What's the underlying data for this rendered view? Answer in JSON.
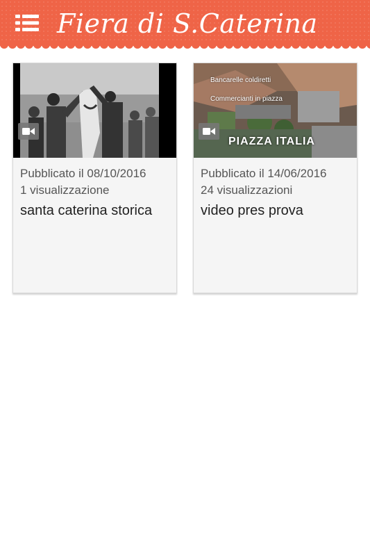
{
  "header": {
    "title": "Fiera di S.Caterina",
    "menu_icon": "hamburger-menu-icon",
    "background_color": "#ef6447"
  },
  "videos": [
    {
      "published": "Pubblicato il 08/10/2016",
      "views": "1 visualizzazione",
      "title": "santa caterina storica",
      "badge_icon": "video-camera-icon"
    },
    {
      "published": "Pubblicato il 14/06/2016",
      "views": "24 visualizzazioni",
      "title": "video pres prova",
      "badge_icon": "video-camera-icon",
      "thumb_lines": [
        "Bancarelle coldiretti",
        "Commercianti in piazza"
      ],
      "thumb_caption": "PIAZZA ITALIA"
    }
  ]
}
